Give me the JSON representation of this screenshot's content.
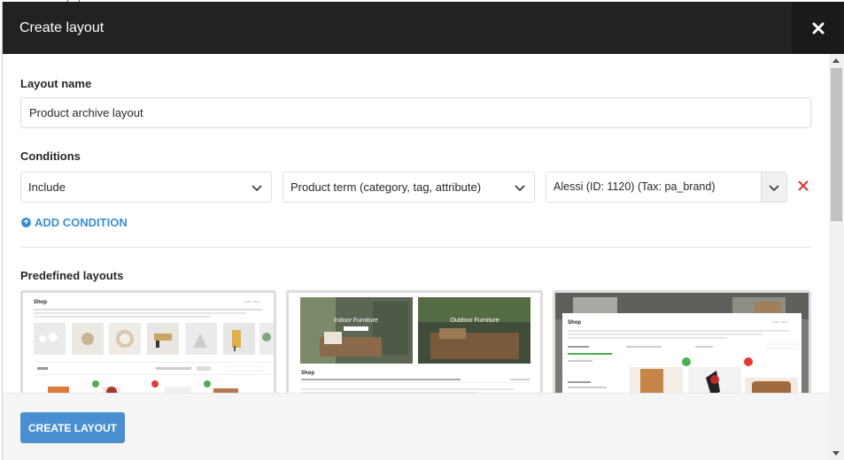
{
  "modal": {
    "title": "Create layout"
  },
  "form": {
    "layout_name_label": "Layout name",
    "layout_name_value": "Product archive layout",
    "conditions_label": "Conditions",
    "condition_type": "Include",
    "condition_target": "Product term (category, tag, attribute)",
    "condition_value": "Alessi (ID: 1120) (Tax: pa_brand)",
    "add_condition_label": "ADD CONDITION",
    "predefined_label": "Predefined layouts"
  },
  "layouts": [
    {
      "shop_title": "Shop",
      "breadcrumb": "Home / Shop"
    },
    {
      "shop_title": "Shop",
      "banner_left": "Indoor Furniture",
      "banner_right": "Outdoor Furniture",
      "breadcrumb": "Home / Shop"
    },
    {
      "shop_title": "Shop",
      "breadcrumb": "Home / Shop"
    }
  ],
  "footer": {
    "create_label": "CREATE LAYOUT"
  },
  "colors": {
    "header_bg": "#222222",
    "accent": "#4a90d0",
    "remove": "#d63638"
  }
}
